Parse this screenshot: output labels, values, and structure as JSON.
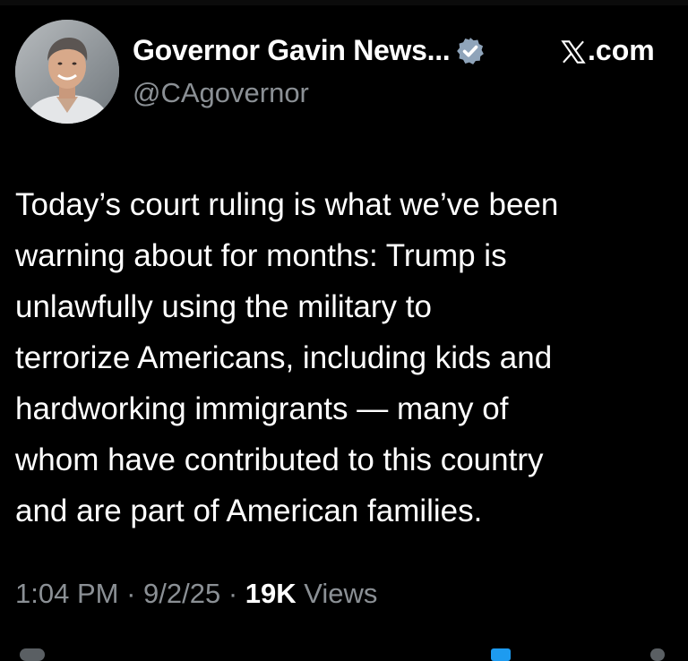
{
  "header": {
    "display_name": "Governor Gavin News...",
    "handle": "@CAgovernor",
    "verified": true,
    "site_label": "com",
    "site_icon": "x-logo-icon",
    "avatar_icon": "avatar"
  },
  "tweet": {
    "text": "Today’s court ruling is what we’ve been\nwarning about for months: Trump is\nunlawfully using the military to\nterrorize Americans, including kids and\nhardworking immigrants — many of\nwhom have contributed to this country\nand are part of American families."
  },
  "meta": {
    "time": "1:04 PM",
    "sep1": " · ",
    "date": "9/2/25",
    "sep2": " · ",
    "views_count": "19K",
    "views_label": " Views"
  },
  "colors": {
    "background": "#000000",
    "text": "#ffffff",
    "muted": "#8b9095",
    "verified_badge": "#1d9bf0"
  }
}
